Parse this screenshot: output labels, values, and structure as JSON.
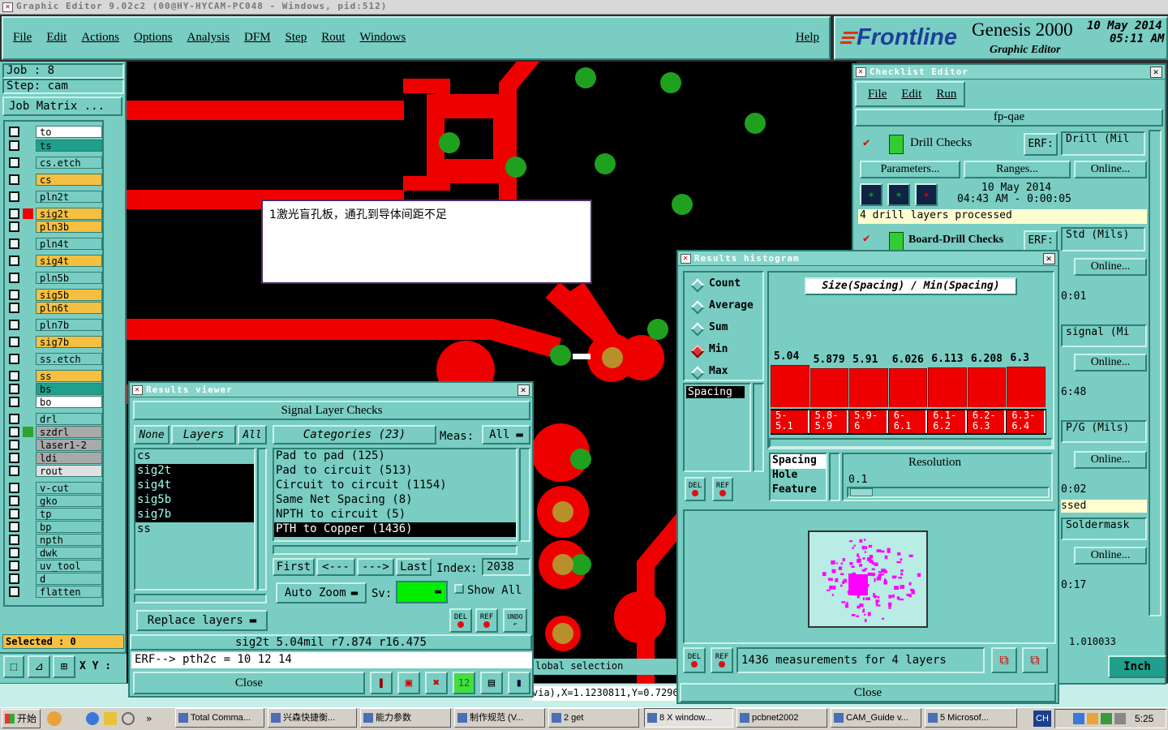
{
  "app": {
    "window_title": "Graphic Editor 9.02c2 (00@HY-HYCAM-PC048 - Windows, pid:512)",
    "menu": [
      "File",
      "Edit",
      "Actions",
      "Options",
      "Analysis",
      "DFM",
      "Step",
      "Rout",
      "Windows"
    ],
    "help": "Help",
    "brand": "Frontline",
    "product": "Genesis 2000",
    "subtitle": "Graphic Editor",
    "date": "10 May 2014",
    "time": "05:11 AM"
  },
  "left": {
    "job": "Job  :  8",
    "step": "Step:  cam",
    "job_matrix": "Job Matrix ...",
    "selected": "Selected : 0",
    "xy": "X Y :",
    "layers": [
      {
        "name": "to",
        "color": "#ffffff",
        "swatch": ""
      },
      {
        "name": "ts",
        "color": "#1f9f8c",
        "swatch": ""
      },
      {
        "name": "cs.etch",
        "color": "#79cdc2",
        "swatch": ""
      },
      {
        "name": "cs",
        "color": "#f5c041",
        "swatch": ""
      },
      {
        "name": "pln2t",
        "color": "#79cdc2",
        "swatch": ""
      },
      {
        "name": "sig2t",
        "color": "#f5c041",
        "swatch": "#ef0000"
      },
      {
        "name": "pln3b",
        "color": "#f5c041",
        "swatch": ""
      },
      {
        "name": "pln4t",
        "color": "#79cdc2",
        "swatch": ""
      },
      {
        "name": "sig4t",
        "color": "#f5c041",
        "swatch": ""
      },
      {
        "name": "pln5b",
        "color": "#79cdc2",
        "swatch": ""
      },
      {
        "name": "sig5b",
        "color": "#f5c041",
        "swatch": ""
      },
      {
        "name": "pln6t",
        "color": "#f5c041",
        "swatch": ""
      },
      {
        "name": "pln7b",
        "color": "#79cdc2",
        "swatch": ""
      },
      {
        "name": "sig7b",
        "color": "#f5c041",
        "swatch": ""
      },
      {
        "name": "ss.etch",
        "color": "#79cdc2",
        "swatch": ""
      },
      {
        "name": "ss",
        "color": "#f5c041",
        "swatch": ""
      },
      {
        "name": "bs",
        "color": "#1f9f8c",
        "swatch": ""
      },
      {
        "name": "bo",
        "color": "#ffffff",
        "swatch": ""
      },
      {
        "name": "drl",
        "color": "#79cdc2",
        "swatch": ""
      },
      {
        "name": "szdrl",
        "color": "#a9a9a9",
        "swatch": "#2fa32f"
      },
      {
        "name": "laser1-2",
        "color": "#a9a9a9",
        "swatch": ""
      },
      {
        "name": "ldi",
        "color": "#a9a9a9",
        "swatch": ""
      },
      {
        "name": "rout",
        "color": "#e0e0e0",
        "swatch": ""
      },
      {
        "name": "v-cut",
        "color": "#79cdc2",
        "swatch": ""
      },
      {
        "name": "gko",
        "color": "#79cdc2",
        "swatch": ""
      },
      {
        "name": "tp",
        "color": "#79cdc2",
        "swatch": ""
      },
      {
        "name": "bp",
        "color": "#79cdc2",
        "swatch": ""
      },
      {
        "name": "npth",
        "color": "#79cdc2",
        "swatch": ""
      },
      {
        "name": "dwk",
        "color": "#79cdc2",
        "swatch": ""
      },
      {
        "name": "uv_tool",
        "color": "#79cdc2",
        "swatch": ""
      },
      {
        "name": "d",
        "color": "#79cdc2",
        "swatch": ""
      },
      {
        "name": "flatten",
        "color": "#79cdc2",
        "swatch": ""
      }
    ]
  },
  "canvas": {
    "note": "1激光盲孔板，通孔到导体间距不足",
    "status_select": "lobal selection",
    "status_coords": "via),X=1.1230811,Y=0.7296"
  },
  "results_viewer": {
    "title": "Results viewer",
    "header": "Signal Layer Checks",
    "none": "None",
    "layers_label": "Layers",
    "all": "All",
    "categories_label": "Categories (23)",
    "meas_label": "Meas:",
    "meas_value": "All",
    "layers": [
      "cs",
      "sig2t",
      "sig4t",
      "sig5b",
      "sig7b",
      "ss"
    ],
    "categories": [
      "Pad to pad (125)",
      "Pad to circuit (513)",
      "Circuit to circuit (1154)",
      "Same Net Spacing (8)",
      "NPTH to circuit (5)",
      "PTH to Copper (1436)"
    ],
    "first": "First",
    "prev": "<---",
    "next": "--->",
    "last": "Last",
    "index_label": "Index:",
    "index_value": "2038",
    "auto_zoom": "Auto Zoom",
    "sv": "Sv:",
    "show_all": "Show All",
    "replace_layers": "Replace layers",
    "del": "DEL",
    "ref": "REF",
    "undo": "UNDO",
    "info": "sig2t 5.04mil  r7.874  r16.475",
    "erf": "ERF--> pth2c = 10 12 14",
    "close": "Close"
  },
  "histogram": {
    "title": "Results histogram",
    "modes": [
      "Count",
      "Average",
      "Sum",
      "Min",
      "Max"
    ],
    "selected_mode": "Min",
    "heading": "Size(Spacing) / Min(Spacing)",
    "values": [
      5.04,
      5.879,
      5.91,
      6.026,
      6.113,
      6.208,
      6.3
    ],
    "value_labels": [
      "5.04",
      "5.879",
      "5.91",
      "6.026",
      "6.113",
      "6.208",
      "6.3"
    ],
    "ranges": [
      "5-\n5.1",
      "5.8-\n5.9",
      "5.9-\n6",
      "6-\n6.1",
      "6.1-\n6.2",
      "6.2-\n6.3",
      "6.3-\n6.4"
    ],
    "list_item": "Spacing",
    "measure_opts": [
      "Spacing",
      "Hole",
      "Feature"
    ],
    "resolution_label": "Resolution",
    "resolution_value": "0.1",
    "measurements": "1436 measurements for 4 layers",
    "close": "Close"
  },
  "checklist": {
    "title": "Checklist Editor",
    "menu": [
      "File",
      "Edit",
      "Run"
    ],
    "name": "fp-qae",
    "drill_checks": "Drill Checks",
    "erf": "ERF:",
    "erf_drill": "Drill (Mil",
    "parameters": "Parameters...",
    "ranges": "Ranges...",
    "online": "Online...",
    "run_date": "10 May 2014",
    "run_time": "04:43 AM - 0:00:05",
    "processed": "4 drill layers processed",
    "board_drill": "Board-Drill Checks",
    "erf_std": "Std (Mils)",
    "t1": "0:01",
    "erf_signal": "signal (Mi",
    "t2": "6:48",
    "erf_pg": "P/G (Mils)",
    "t3": "0:02",
    "sed": "ssed",
    "erf_sm": "Soldermask",
    "t4": "0:17",
    "t5": "1.010033"
  },
  "units": "Inch",
  "taskbar": {
    "start": "开始",
    "items": [
      "Total Comma...",
      "兴森快捷衡...",
      "能力参数",
      "制作规范 (V...",
      "2 get",
      "8 X window...",
      "pcbnet2002",
      "CAM_Guide v...",
      "5 Microsof..."
    ],
    "lang": "CH",
    "clock": "5:25"
  }
}
